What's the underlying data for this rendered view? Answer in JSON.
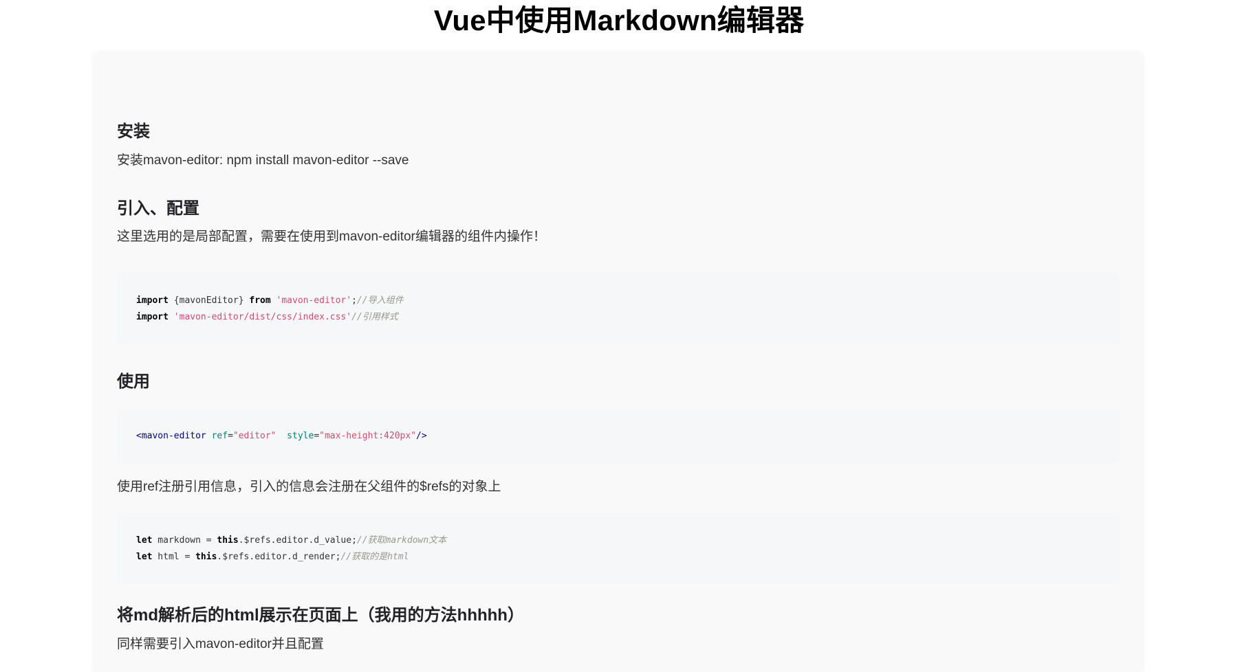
{
  "page": {
    "title": "Vue中使用Markdown编辑器"
  },
  "sections": {
    "install": {
      "heading": "安装",
      "text": "安装mavon-editor: npm install mavon-editor --save"
    },
    "import": {
      "heading": "引入、配置",
      "text": "这里选用的是局部配置，需要在使用到mavon-editor编辑器的组件内操作！",
      "code": {
        "line1_kw1": "import",
        "line1_plain1": " {mavonEditor} ",
        "line1_kw2": "from",
        "line1_str": " 'mavon-editor'",
        "line1_plain2": ";",
        "line1_cmt": "//导入组件",
        "line2_kw1": "import",
        "line2_str": " 'mavon-editor/dist/css/index.css'",
        "line2_cmt": "//引用样式"
      }
    },
    "usage": {
      "heading": "使用",
      "code": {
        "tag_open": "<mavon-editor",
        "attr1": " ref",
        "eq1": "=",
        "val1": "\"editor\"",
        "attr2": "  style",
        "eq2": "=",
        "val2": "\"max-height:420px\"",
        "tag_close": "/>"
      },
      "text": "使用ref注册引用信息，引入的信息会注册在父组件的$refs的对象上",
      "code2": {
        "line1_kw1": "let",
        "line1_plain1": " markdown = ",
        "line1_kw2": "this",
        "line1_plain2": ".$refs.editor.d_value;",
        "line1_cmt": "//获取markdown文本",
        "line2_kw1": "let",
        "line2_plain1": " html = ",
        "line2_kw2": "this",
        "line2_plain2": ".$refs.editor.d_render;",
        "line2_cmt": "//获取的是html"
      }
    },
    "render": {
      "heading": "将md解析后的html展示在页面上（我用的方法hhhhh）",
      "text": "同样需要引入mavon-editor并且配置"
    }
  },
  "colors": {
    "keyword": "#000000",
    "string": "#d14c6e",
    "comment": "#999988",
    "tag": "#000080",
    "attribute": "#008080",
    "code_background": "#f6f7f8",
    "article_background": "#f9f9fa"
  }
}
